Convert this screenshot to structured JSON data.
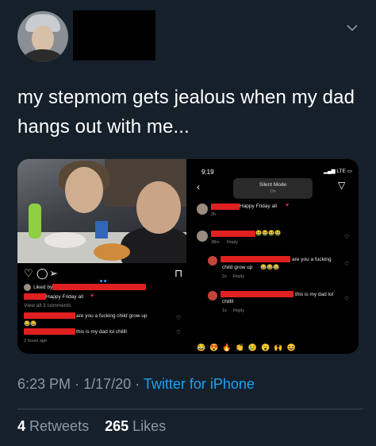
{
  "tweet": {
    "text": "my stepmom gets jealous when my dad hangs out with me...",
    "time": "6:23 PM",
    "sep1": "·",
    "date": "1/17/20",
    "sep2": "·",
    "source": "Twitter for iPhone",
    "retweets_count": "4",
    "retweets_label": "Retweets",
    "likes_count": "265",
    "likes_label": "Likes"
  },
  "left_screenshot": {
    "liked_by": "Liked by",
    "caption": "Happy Friday all",
    "view_comments": "View all 3 comments",
    "comment1": "are you a fucking child grow up",
    "comment2": "this is my dad lol chillll",
    "time_ago": "2 hours ago"
  },
  "right_screenshot": {
    "status_time": "9:19",
    "network": "LTE",
    "silent_title": "Silent Mode",
    "silent_state": "On",
    "post_caption": "Happy Friday all",
    "post_age": "2h",
    "c1_age": "38m",
    "c1_reply": "Reply",
    "c2_text_a": "are you a fucking",
    "c2_text_b": "child grow up",
    "c2_age": "2s",
    "c2_reply": "Reply",
    "c3_text": "this is my dad lol",
    "c3_text_b": "chillll",
    "c3_age": "1s",
    "c3_reply": "Reply"
  },
  "colors": {
    "background": "#15202b",
    "text_primary": "#ffffff",
    "text_secondary": "#8899a6",
    "link": "#1da1f2",
    "redaction": "#e02020"
  },
  "icons": [
    "chevron-down-icon",
    "heart-icon",
    "comment-icon",
    "share-icon",
    "bookmark-icon",
    "back-arrow-icon",
    "send-icon"
  ]
}
